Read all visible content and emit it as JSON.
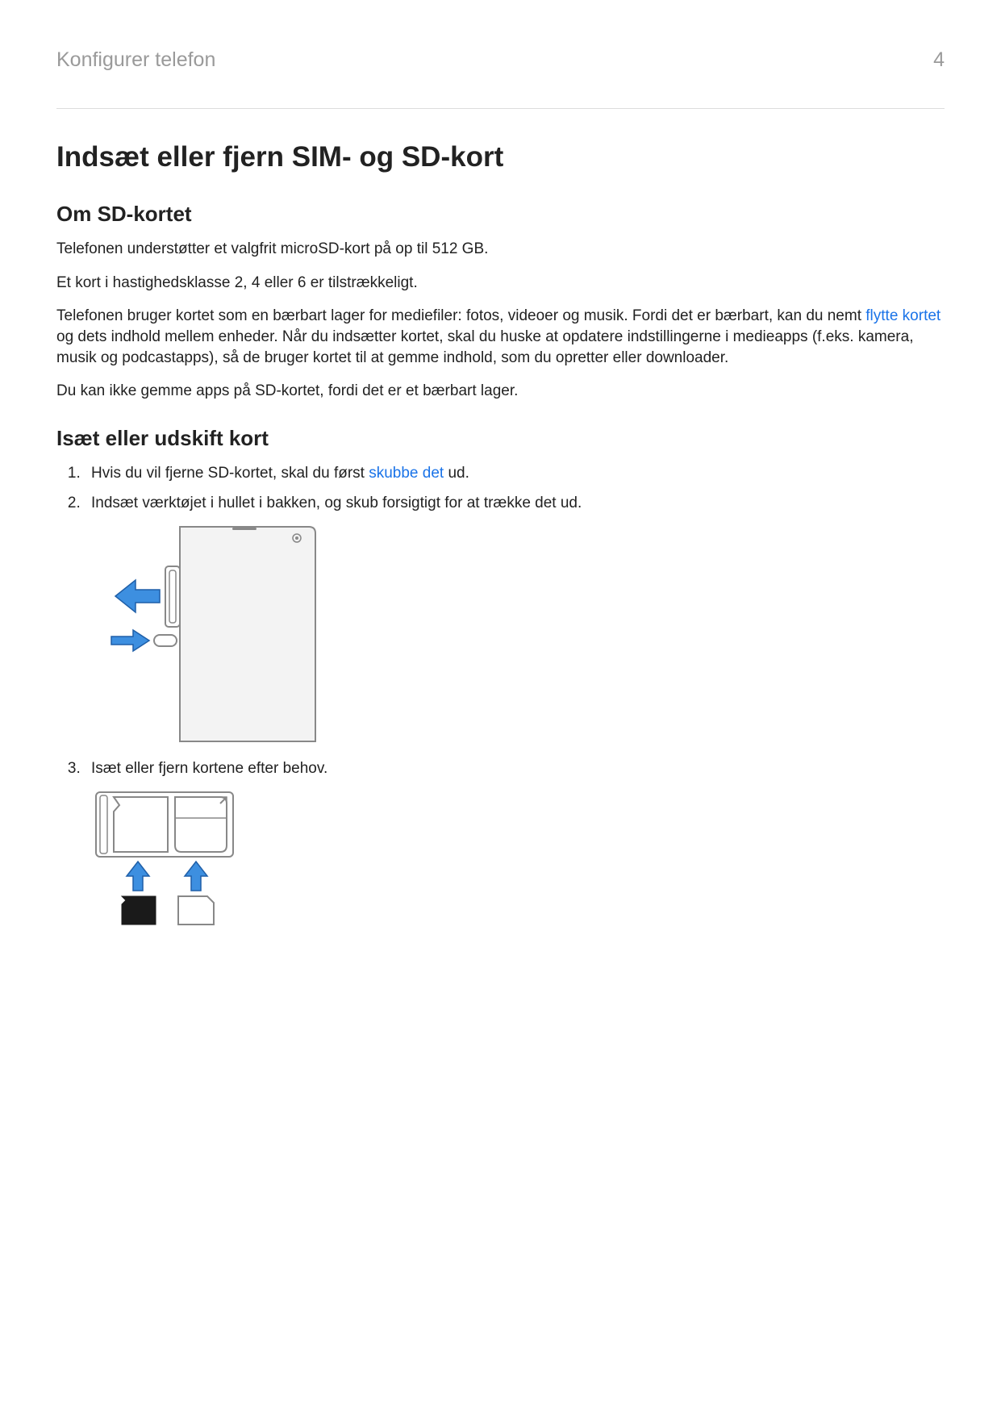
{
  "header": {
    "breadcrumb": "Konfigurer telefon",
    "page_number": "4"
  },
  "title": "Indsæt eller fjern SIM- og SD-kort",
  "section1": {
    "heading": "Om SD-kortet",
    "p1": "Telefonen understøtter et valgfrit microSD-kort på op til 512 GB.",
    "p2": "Et kort i hastighedsklasse 2, 4 eller 6 er tilstrækkeligt.",
    "p3a": "Telefonen bruger kortet som en bærbart lager for mediefiler: fotos, videoer og musik. Fordi det er bærbart, kan du nemt ",
    "p3link": "flytte kortet",
    "p3b": " og dets indhold mellem enheder. Når du indsætter kortet, skal du huske at opdatere indstillingerne i medieapps (f.eks. kamera, musik og podcastapps), så de bruger kortet til at gemme indhold, som du opretter eller downloader.",
    "p4": "Du kan ikke gemme apps på SD-kortet, fordi det er et bærbart lager."
  },
  "section2": {
    "heading": "Isæt eller udskift kort",
    "step1a": "Hvis du vil fjerne SD-kortet, skal du først ",
    "step1link": "skubbe det",
    "step1b": " ud.",
    "step2": "Indsæt værktøjet i hullet i bakken, og skub forsigtigt for at trække det ud.",
    "step3": "Isæt eller fjern kortene efter behov."
  }
}
